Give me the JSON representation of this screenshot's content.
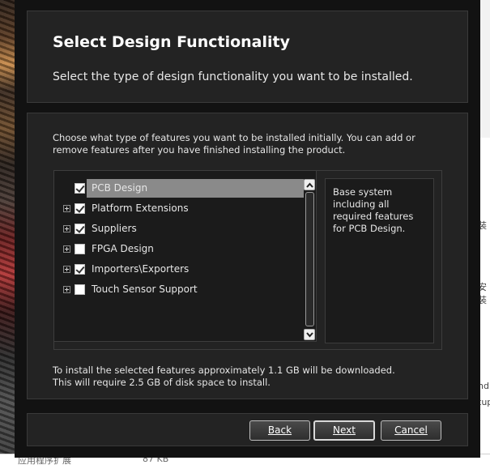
{
  "window": {
    "title": "Select Design Functionality",
    "subtitle": "Select the type of design functionality you want to be installed."
  },
  "intro": "Choose what type of features you want to be installed initially. You can add or remove features after you have finished installing the product.",
  "features": [
    {
      "label": "PCB Design",
      "checked": true,
      "expandable": false,
      "selected": true
    },
    {
      "label": "Platform Extensions",
      "checked": true,
      "expandable": true,
      "selected": false
    },
    {
      "label": "Suppliers",
      "checked": true,
      "expandable": true,
      "selected": false
    },
    {
      "label": "FPGA Design",
      "checked": false,
      "expandable": true,
      "selected": false
    },
    {
      "label": "Importers\\Exporters",
      "checked": true,
      "expandable": true,
      "selected": false
    },
    {
      "label": "Touch Sensor Support",
      "checked": false,
      "expandable": true,
      "selected": false
    }
  ],
  "description": "Base system including all required features for PCB Design.",
  "footer": {
    "line1": "To install the selected features approximately 1.1 GB will be downloaded.",
    "line2": "This will require 2.5 GB of disk space to install."
  },
  "buttons": {
    "back": "Back",
    "next": "Next",
    "cancel": "Cancel"
  },
  "background": {
    "bottom_left": "应用程序扩展",
    "bottom_mid": "87 KB",
    "right_texts": [
      "装",
      "安装",
      "nd",
      "tup"
    ]
  }
}
